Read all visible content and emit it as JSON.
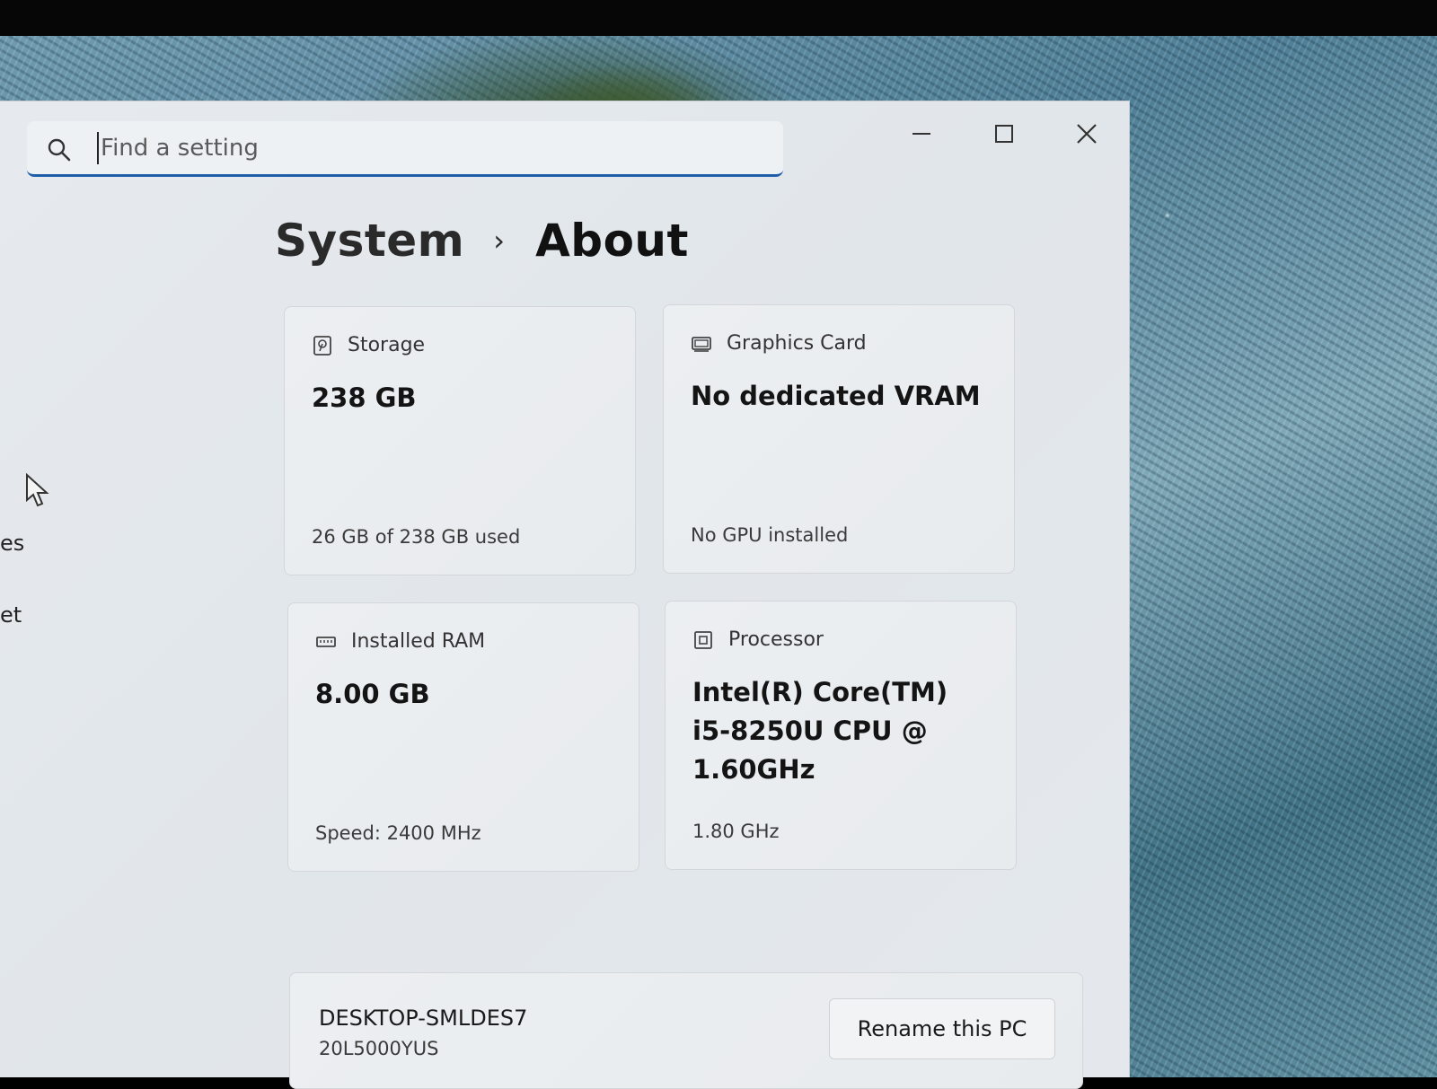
{
  "search": {
    "placeholder": "Find a setting"
  },
  "breadcrumb": {
    "parent": "System",
    "separator": "›",
    "current": "About"
  },
  "window_controls": [
    "minimize-icon",
    "maximize-icon",
    "close-icon"
  ],
  "sidebar": {
    "partial_items": [
      "es",
      "et"
    ]
  },
  "cards": [
    {
      "icon": "storage-icon",
      "title": "Storage",
      "value": "238 GB",
      "sub": "26 GB of 238 GB used"
    },
    {
      "icon": "graphics-card-icon",
      "title": "Graphics Card",
      "value": "No dedicated VRAM",
      "sub": "No GPU installed"
    },
    {
      "icon": "ram-icon",
      "title": "Installed RAM",
      "value": "8.00 GB",
      "sub": "Speed: 2400 MHz"
    },
    {
      "icon": "processor-icon",
      "title": "Processor",
      "value": "Intel(R) Core(TM) i5-8250U CPU @ 1.60GHz",
      "sub": "1.80 GHz"
    }
  ],
  "device": {
    "name": "DESKTOP-SMLDES7",
    "model": "20L5000YUS",
    "rename_label": "Rename this PC"
  },
  "colors": {
    "accent": "#1f5fa8",
    "window_bg": "#e4e8ec",
    "card_border": "#d3d7db"
  }
}
